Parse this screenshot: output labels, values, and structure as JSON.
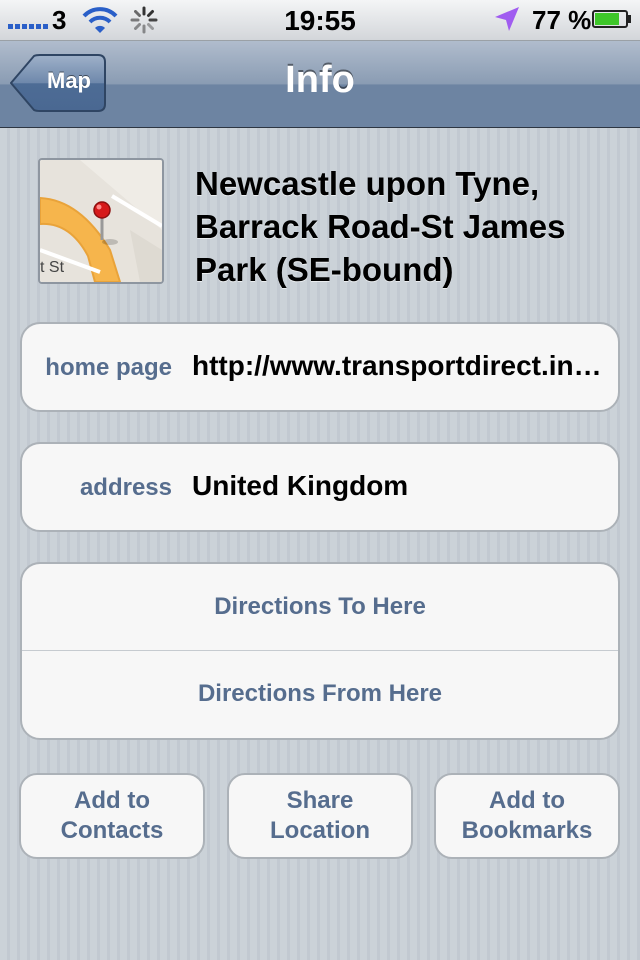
{
  "status_bar": {
    "carrier": "3",
    "time": "19:55",
    "battery_percent": "77 %",
    "icons": [
      "signal-bars-icon",
      "wifi-icon",
      "activity-spinner-icon",
      "location-arrow-icon",
      "battery-icon"
    ]
  },
  "nav": {
    "back_label": "Map",
    "title": "Info"
  },
  "place": {
    "title": "Newcastle upon Tyne, Barrack Road-St James Park (SE-bound)",
    "map_thumb_label": "t St"
  },
  "details": {
    "home_page": {
      "label": "home page",
      "value": "http://www.transportdirect.info/"
    },
    "address": {
      "label": "address",
      "value": "United Kingdom"
    }
  },
  "directions": {
    "to_here": "Directions To Here",
    "from_here": "Directions From Here"
  },
  "buttons": {
    "add_contacts": [
      "Add to",
      "Contacts"
    ],
    "share_location": [
      "Share",
      "Location"
    ],
    "add_bookmarks": [
      "Add to",
      "Bookmarks"
    ]
  },
  "colors": {
    "nav_blue": "#6d84a2",
    "label_blue": "#566d8e",
    "group_bg": "#f7f7f7",
    "location_purple": "#a05cf0",
    "battery_green": "#3ec629"
  }
}
